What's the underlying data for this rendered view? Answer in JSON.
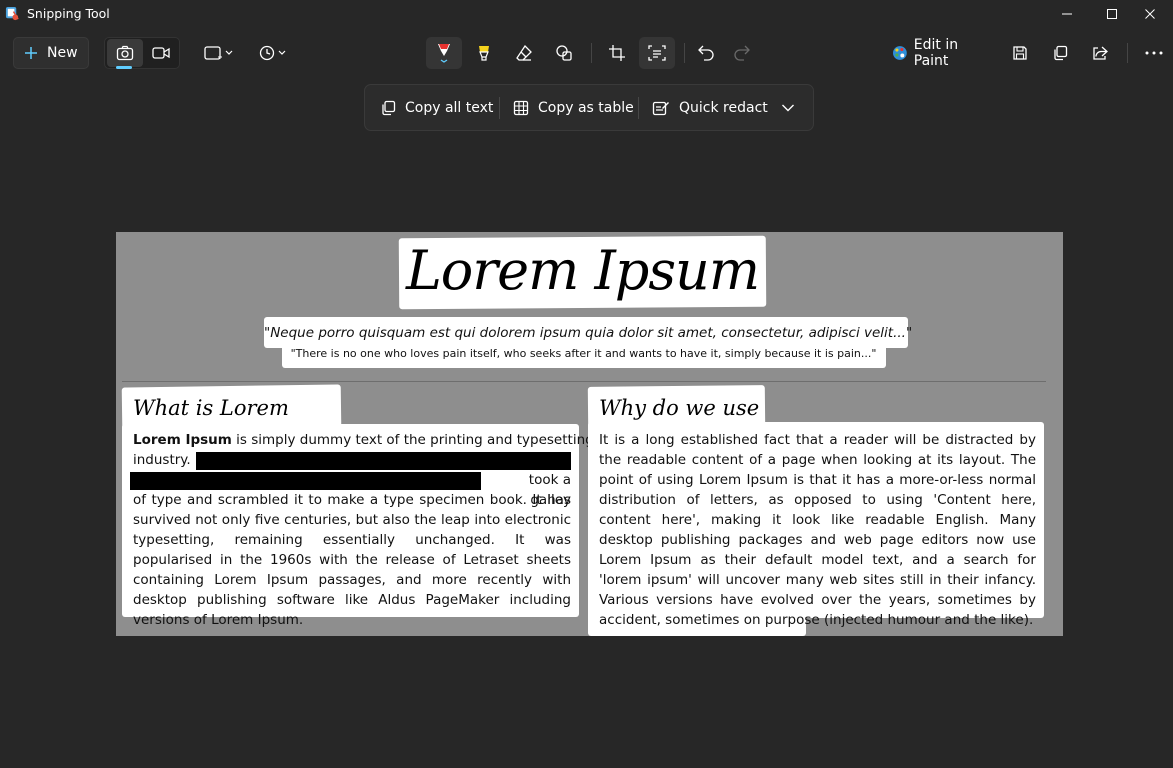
{
  "window": {
    "title": "Snipping Tool"
  },
  "toolbar": {
    "new_label": "New",
    "edit_in_paint_label": "Edit in Paint"
  },
  "text_actions": {
    "copy_all_text": "Copy all text",
    "copy_as_table": "Copy as table",
    "quick_redact": "Quick redact"
  },
  "capture": {
    "title": "Lorem Ipsum",
    "quote_italic": "\"Neque porro quisquam est qui dolorem ipsum quia dolor sit amet, consectetur, adipisci velit...\"",
    "quote_plain": "\"There is no one who loves pain itself, who seeks after it and wants to have it, simply because it is pain...\"",
    "left": {
      "heading": "What is Lorem Ipsum?",
      "bold_lead": "Lorem Ipsum",
      "line1_rest": " is simply dummy text of the printing and typesetting",
      "line2": "industry.",
      "line3_tail": "took a galley",
      "body_rest": "of type and scrambled it to make a type specimen book. It has survived not only five centuries, but also the leap into electronic typesetting, remaining essentially unchanged. It was popularised in the 1960s with the release of Letraset sheets containing Lorem Ipsum passages, and more recently with desktop publishing software like Aldus PageMaker including versions of Lorem Ipsum."
    },
    "right": {
      "heading": "Why do we use it?",
      "body": "It is a long established fact that a reader will be distracted by the readable content of a page when looking at its layout. The point of using Lorem Ipsum is that it has a more-or-less normal distribution of letters, as opposed to using 'Content here, content here', making it look like readable English. Many desktop publishing packages and web page editors now use Lorem Ipsum as their default model text, and a search for 'lorem ipsum' will uncover many web sites still in their infancy. Various versions have evolved over the years, sometimes by accident, sometimes on purpose (injected humour and the like)."
    }
  },
  "colors": {
    "background": "#272727",
    "accent": "#60cdff",
    "capture_background": "#8e8e8e",
    "redact": "#000000"
  }
}
